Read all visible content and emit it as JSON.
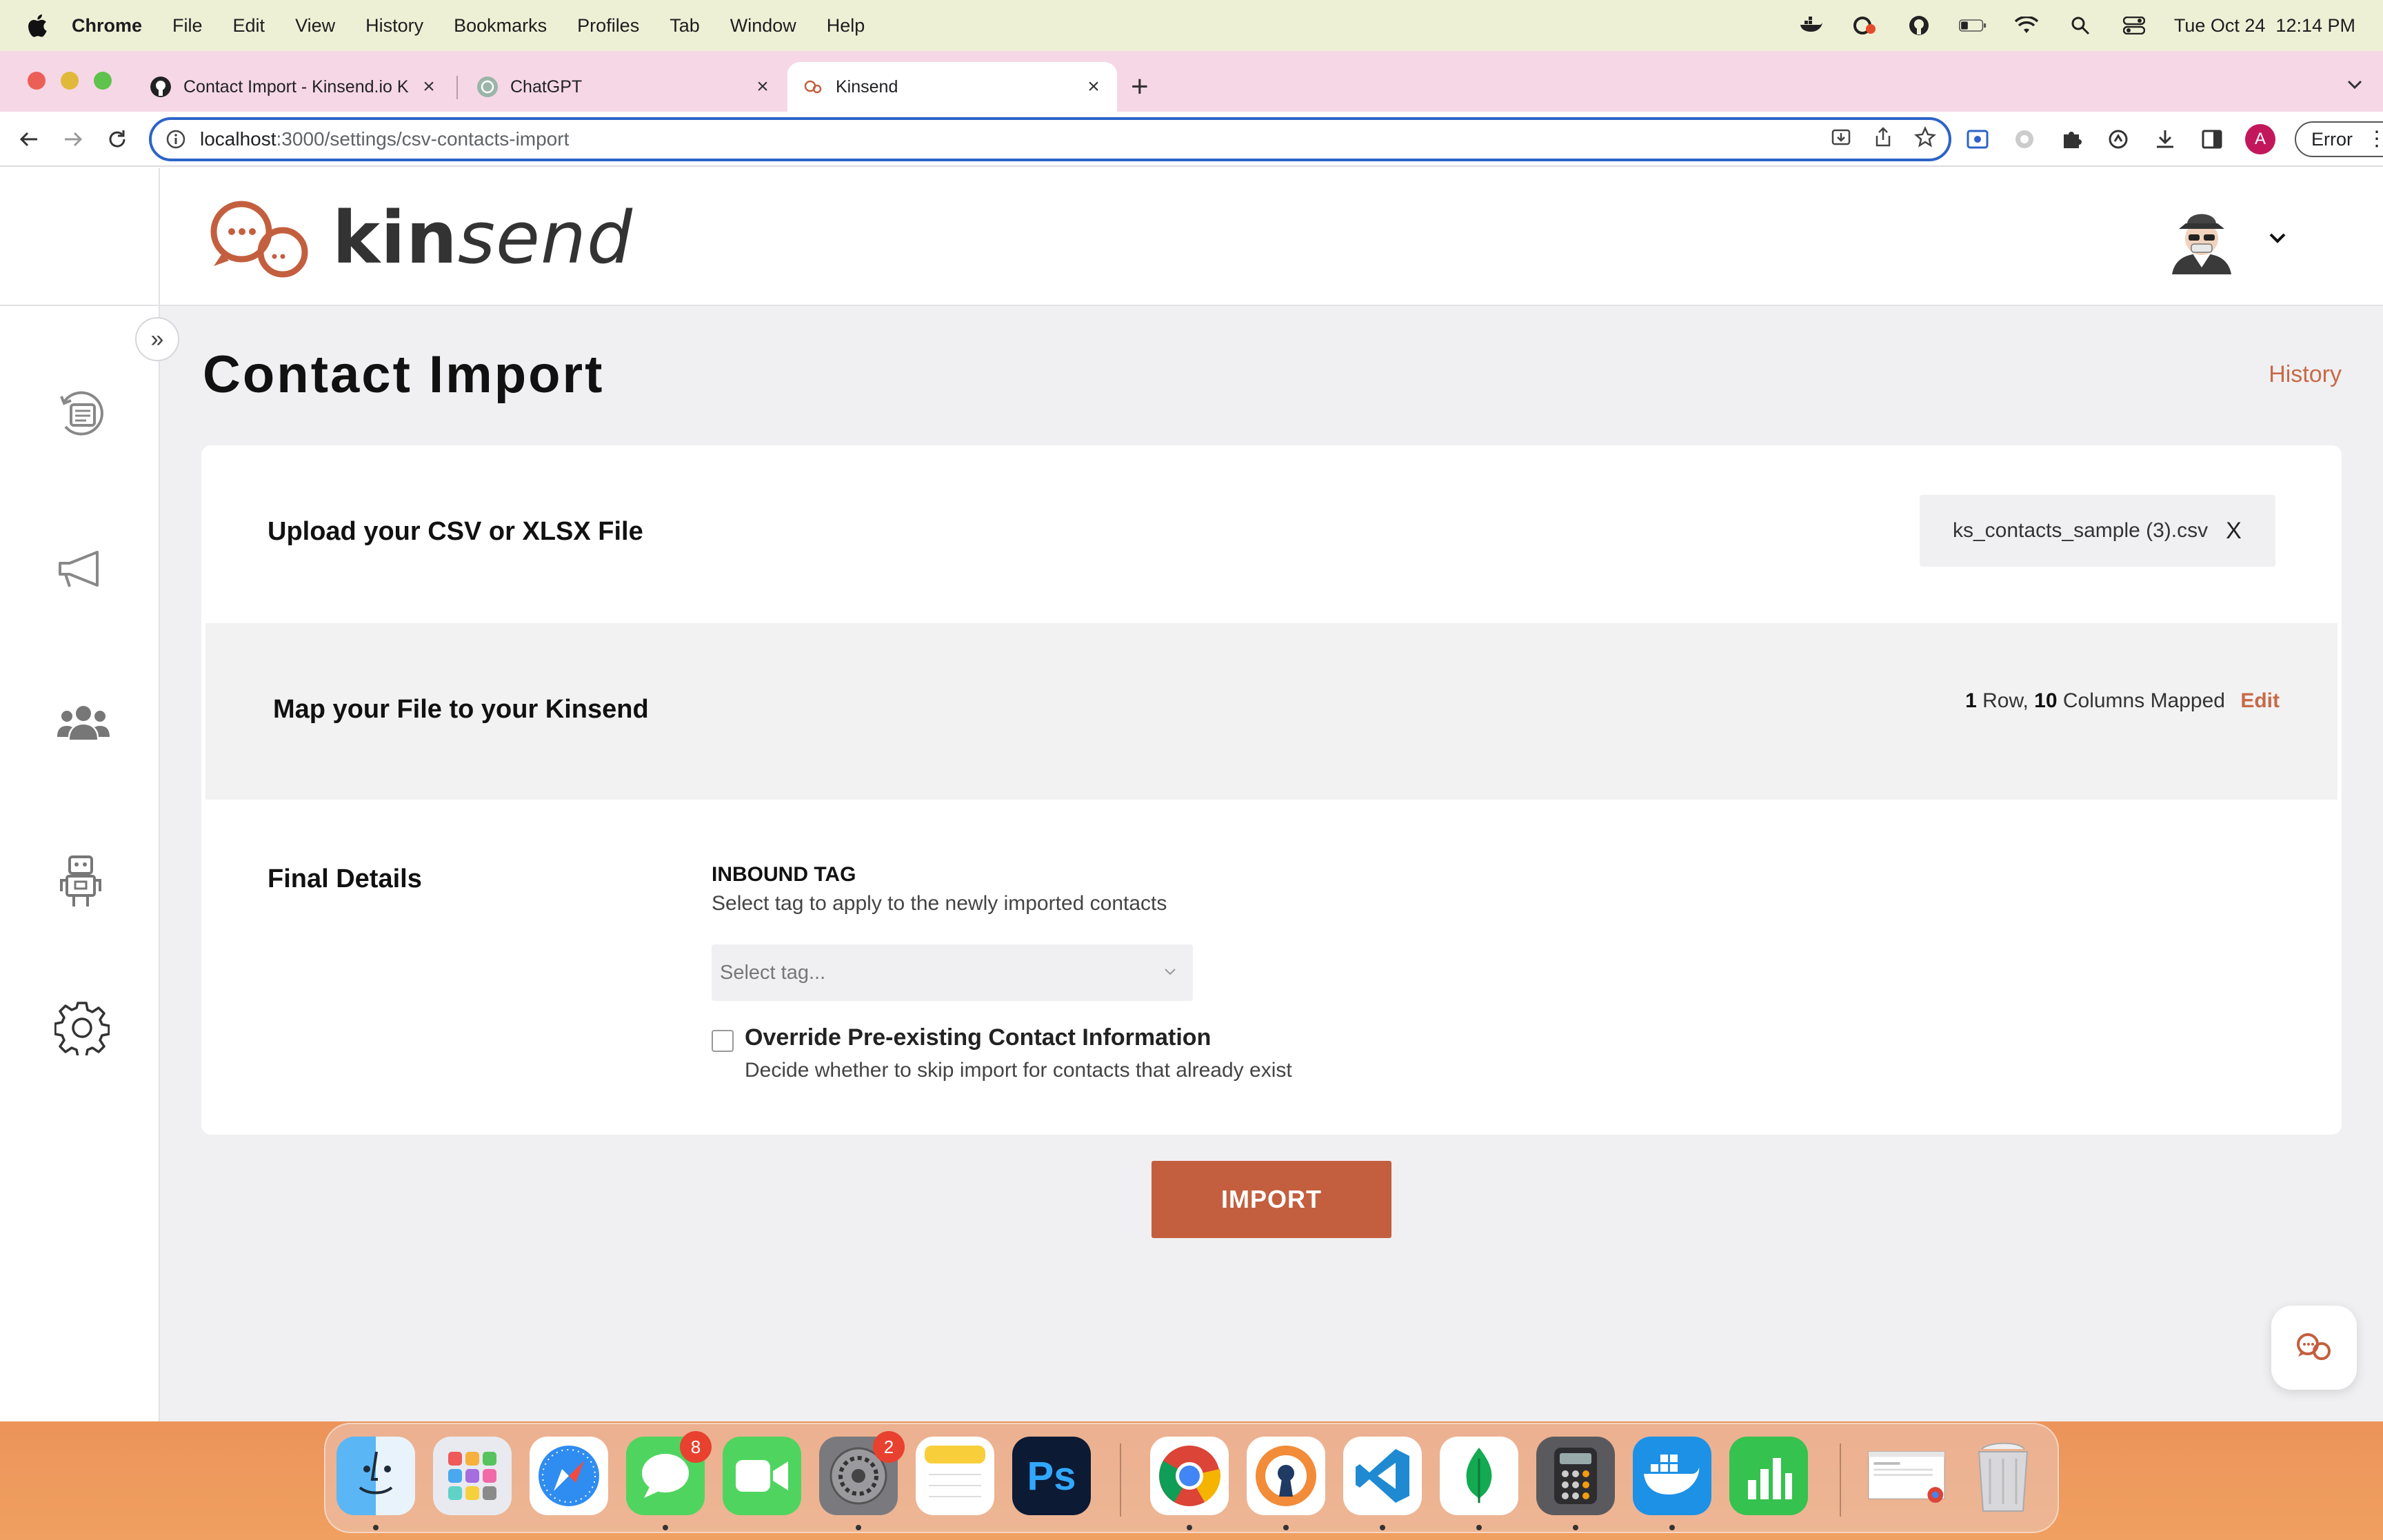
{
  "menubar": {
    "app": "Chrome",
    "items": [
      "File",
      "Edit",
      "View",
      "History",
      "Bookmarks",
      "Profiles",
      "Tab",
      "Window",
      "Help"
    ],
    "datetime": "Tue Oct 24  12:14 PM"
  },
  "browser": {
    "tabs": [
      {
        "title": "Contact Import - Kinsend.io K",
        "icon": "github-icon"
      },
      {
        "title": "ChatGPT",
        "icon": "chatgpt-icon"
      },
      {
        "title": "Kinsend",
        "icon": "kinsend-icon",
        "active": true
      }
    ],
    "url_host": "localhost",
    "url_path": ":3000/settings/csv-contacts-import",
    "profile_initial": "A",
    "error_label": "Error"
  },
  "app": {
    "brand_bold": "kin",
    "brand_light": "send",
    "page_title": "Contact Import",
    "history_link": "History",
    "upload": {
      "label": "Upload your CSV or XLSX File",
      "file_name": "ks_contacts_sample (3).csv",
      "remove": "X"
    },
    "map": {
      "label": "Map your File to your Kinsend",
      "rows": "1",
      "rows_word": "Row,",
      "cols": "10",
      "cols_word": "Columns Mapped",
      "edit": "Edit"
    },
    "final": {
      "label": "Final Details",
      "tag_heading": "INBOUND TAG",
      "tag_sub": "Select tag to apply to the newly imported contacts",
      "tag_placeholder": "Select tag...",
      "override_label": "Override Pre-existing Contact Information",
      "override_sub": "Decide whether to skip import for contacts that already exist",
      "override_checked": false
    },
    "import_button": "IMPORT",
    "accent_color": "#c35f3e"
  },
  "dock": {
    "messages_badge": "8",
    "settings_badge": "2"
  }
}
